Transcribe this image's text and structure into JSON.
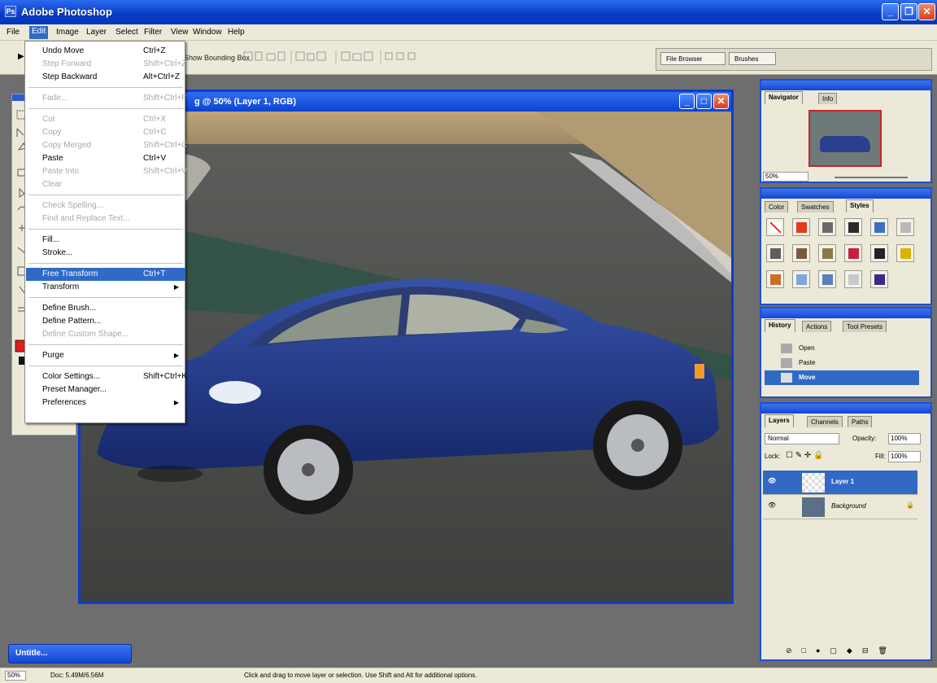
{
  "app": {
    "title": "Adobe Photoshop",
    "icon_text": "Ps"
  },
  "window_controls": [
    "minimize-icon",
    "restore-icon",
    "close-icon"
  ],
  "menubar": {
    "items": [
      "File",
      "Edit",
      "Image",
      "Layer",
      "Select",
      "Filter",
      "View",
      "Window",
      "Help"
    ],
    "active": "Edit"
  },
  "options_bar": {
    "show_bounding_box": "Show Bounding Box",
    "tabs": [
      "File Browser",
      "Brushes"
    ]
  },
  "edit_menu": {
    "items": [
      {
        "label": "Undo Move",
        "shortcut": "Ctrl+Z",
        "disabled": false
      },
      {
        "label": "Step Forward",
        "shortcut": "Shift+Ctrl+Z",
        "disabled": true
      },
      {
        "label": "Step Backward",
        "shortcut": "Alt+Ctrl+Z",
        "disabled": false
      },
      {
        "label": "Fade...",
        "shortcut": "Shift+Ctrl+F",
        "disabled": true
      },
      {
        "label": "Cut",
        "shortcut": "Ctrl+X",
        "disabled": true
      },
      {
        "label": "Copy",
        "shortcut": "Ctrl+C",
        "disabled": true
      },
      {
        "label": "Copy Merged",
        "shortcut": "Shift+Ctrl+C",
        "disabled": true
      },
      {
        "label": "Paste",
        "shortcut": "Ctrl+V",
        "disabled": false
      },
      {
        "label": "Paste Into",
        "shortcut": "Shift+Ctrl+V",
        "disabled": true
      },
      {
        "label": "Clear",
        "shortcut": "",
        "disabled": true
      },
      {
        "label": "Check Spelling...",
        "shortcut": "",
        "disabled": true
      },
      {
        "label": "Find and Replace Text...",
        "shortcut": "",
        "disabled": true
      },
      {
        "label": "Fill...",
        "shortcut": "",
        "disabled": false
      },
      {
        "label": "Stroke...",
        "shortcut": "",
        "disabled": false
      },
      {
        "label": "Free Transform",
        "shortcut": "Ctrl+T",
        "disabled": false,
        "selected": true
      },
      {
        "label": "Transform",
        "shortcut": "",
        "disabled": false,
        "submenu": true
      },
      {
        "label": "Define Brush...",
        "shortcut": "",
        "disabled": false
      },
      {
        "label": "Define Pattern...",
        "shortcut": "",
        "disabled": false
      },
      {
        "label": "Define Custom Shape...",
        "shortcut": "",
        "disabled": true
      },
      {
        "label": "Purge",
        "shortcut": "",
        "disabled": false,
        "submenu": true
      },
      {
        "label": "Color Settings...",
        "shortcut": "Shift+Ctrl+K",
        "disabled": false
      },
      {
        "label": "Preset Manager...",
        "shortcut": "",
        "disabled": false
      },
      {
        "label": "Preferences",
        "shortcut": "",
        "disabled": false,
        "submenu": true
      }
    ]
  },
  "document": {
    "title": "g @ 50% (Layer 1, RGB)"
  },
  "navigator": {
    "tabs": [
      "Navigator",
      "Info"
    ],
    "zoom": "50%"
  },
  "styles_panel": {
    "tabs": [
      "Color",
      "Swatches",
      "Styles"
    ],
    "swatch_colors": [
      "#ffffff",
      "#e23a1a",
      "#6a6a6a",
      "#2a2a2a",
      "#3f6fc2",
      "#b9b9b9",
      "#5d5d5d",
      "#7a5a3a",
      "#8a7a4a",
      "#c8203a",
      "#222222",
      "#d9b400",
      "#c8702a",
      "#7fa6d8",
      "#5b7fb6",
      "#c9c9c9",
      "#3a2a8a"
    ]
  },
  "history": {
    "tabs": [
      "History",
      "Actions",
      "Tool Presets"
    ],
    "items": [
      "Open",
      "Paste",
      "Move"
    ]
  },
  "layers": {
    "tabs": [
      "Layers",
      "Channels",
      "Paths"
    ],
    "blend_mode": "Normal",
    "opacity_label": "Opacity:",
    "opacity": "100%",
    "lock_label": "Lock:",
    "fill_label": "Fill:",
    "fill": "100%",
    "items": [
      {
        "name": "Layer 1",
        "selected": true
      },
      {
        "name": "Background",
        "selected": false
      }
    ]
  },
  "taskbar": {
    "label": "Untitle..."
  },
  "status": {
    "zoom": "50%",
    "doc": "Doc: 5.49M/6.56M",
    "hint": "Click and drag to move layer or selection. Use Shift and Alt for additional options."
  }
}
